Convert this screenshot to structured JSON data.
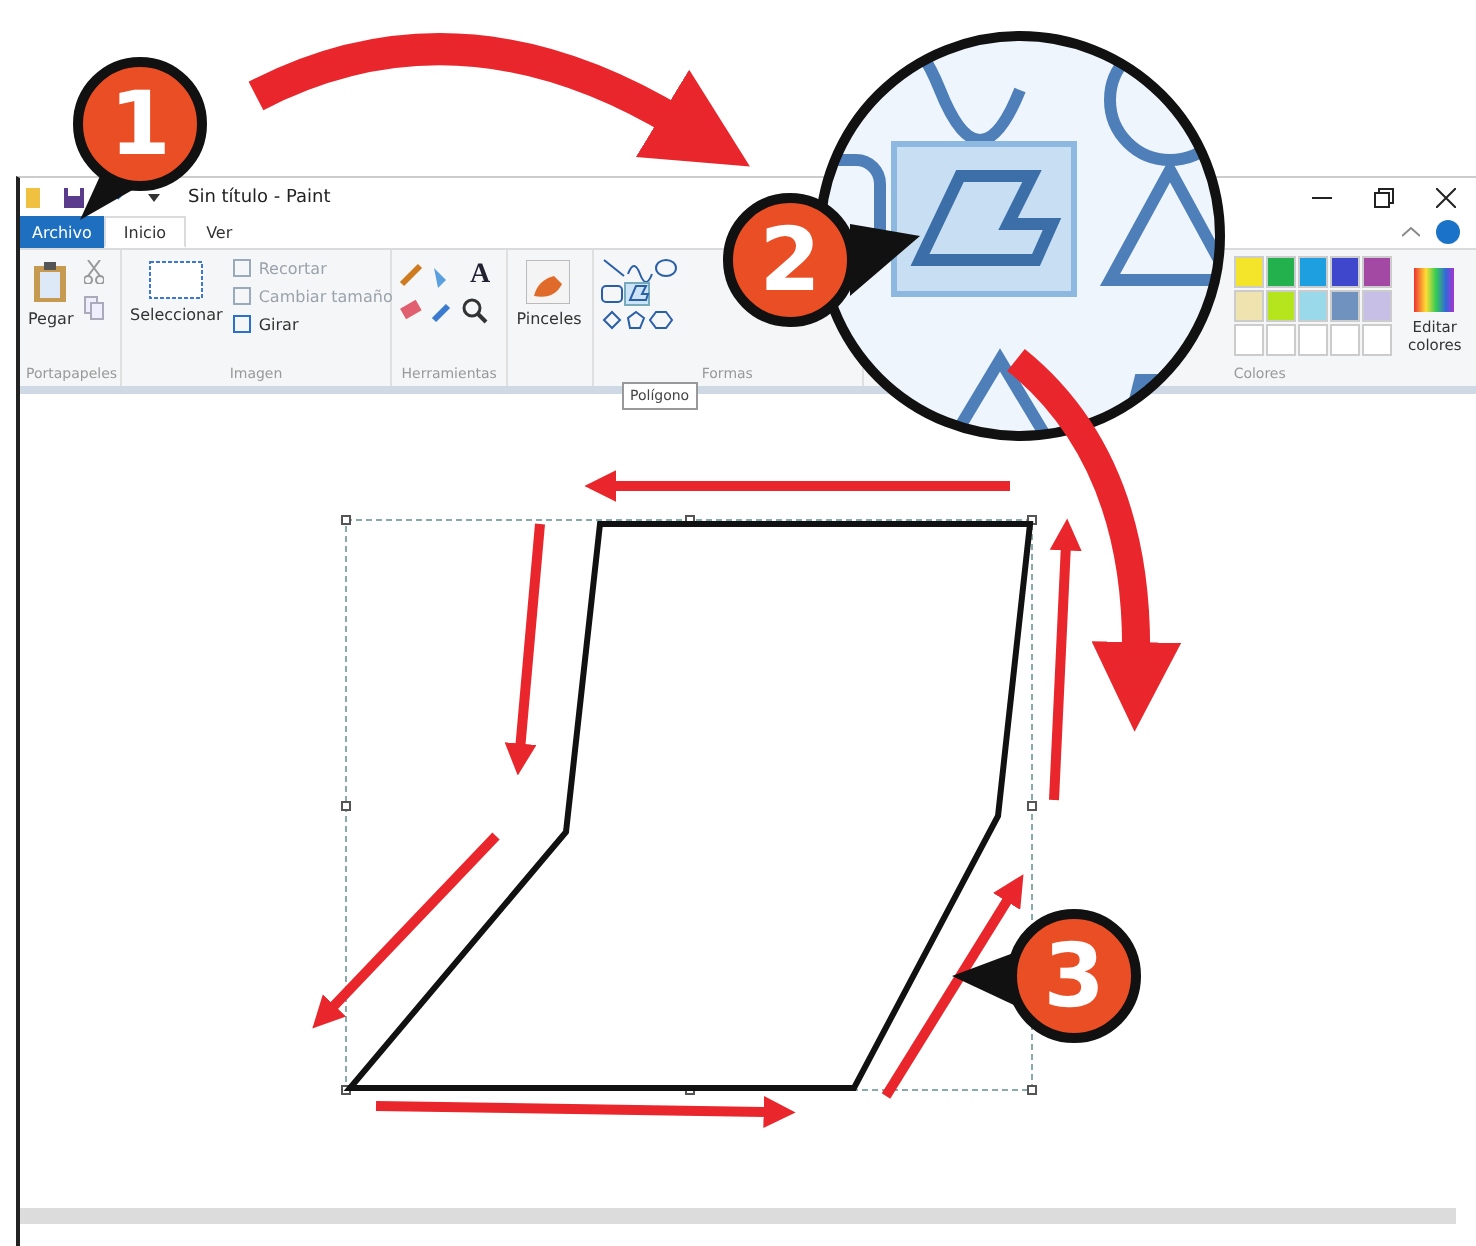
{
  "window": {
    "title": "Sin título - Paint"
  },
  "tabs": [
    {
      "label": "Archivo",
      "kind": "file",
      "selected": false
    },
    {
      "label": "Inicio",
      "kind": "tab",
      "selected": true
    },
    {
      "label": "Ver",
      "kind": "tab",
      "selected": false
    }
  ],
  "clipboard": {
    "label": "Portapapeles",
    "paste": "Pegar"
  },
  "image": {
    "label": "Imagen",
    "select": "Seleccionar",
    "commands": [
      {
        "label": "Recortar",
        "disabled": true
      },
      {
        "label": "Cambiar tamaño",
        "disabled": true
      },
      {
        "label": "Girar",
        "disabled": false
      }
    ]
  },
  "tools": {
    "label": "Herramientas",
    "text_tool": "A"
  },
  "brushes": {
    "label": "Pinceles"
  },
  "shapes": {
    "label": "Formas",
    "tooltip": "Polígono"
  },
  "colors": {
    "label": "Colores",
    "edit": "Editar colores",
    "palette": [
      {
        "color": "#f5e52a"
      },
      {
        "color": "#22b14c"
      },
      {
        "color": "#1ea0e0"
      },
      {
        "color": "#3f48cc"
      },
      {
        "color": "#a349a4"
      },
      {
        "color": "#efe4b0"
      },
      {
        "color": "#b5e61d"
      },
      {
        "color": "#99d9ea"
      },
      {
        "color": "#7092be"
      },
      {
        "color": "#c8bfe7"
      }
    ]
  },
  "steps": [
    {
      "number": "1"
    },
    {
      "number": "2"
    },
    {
      "number": "3"
    }
  ]
}
